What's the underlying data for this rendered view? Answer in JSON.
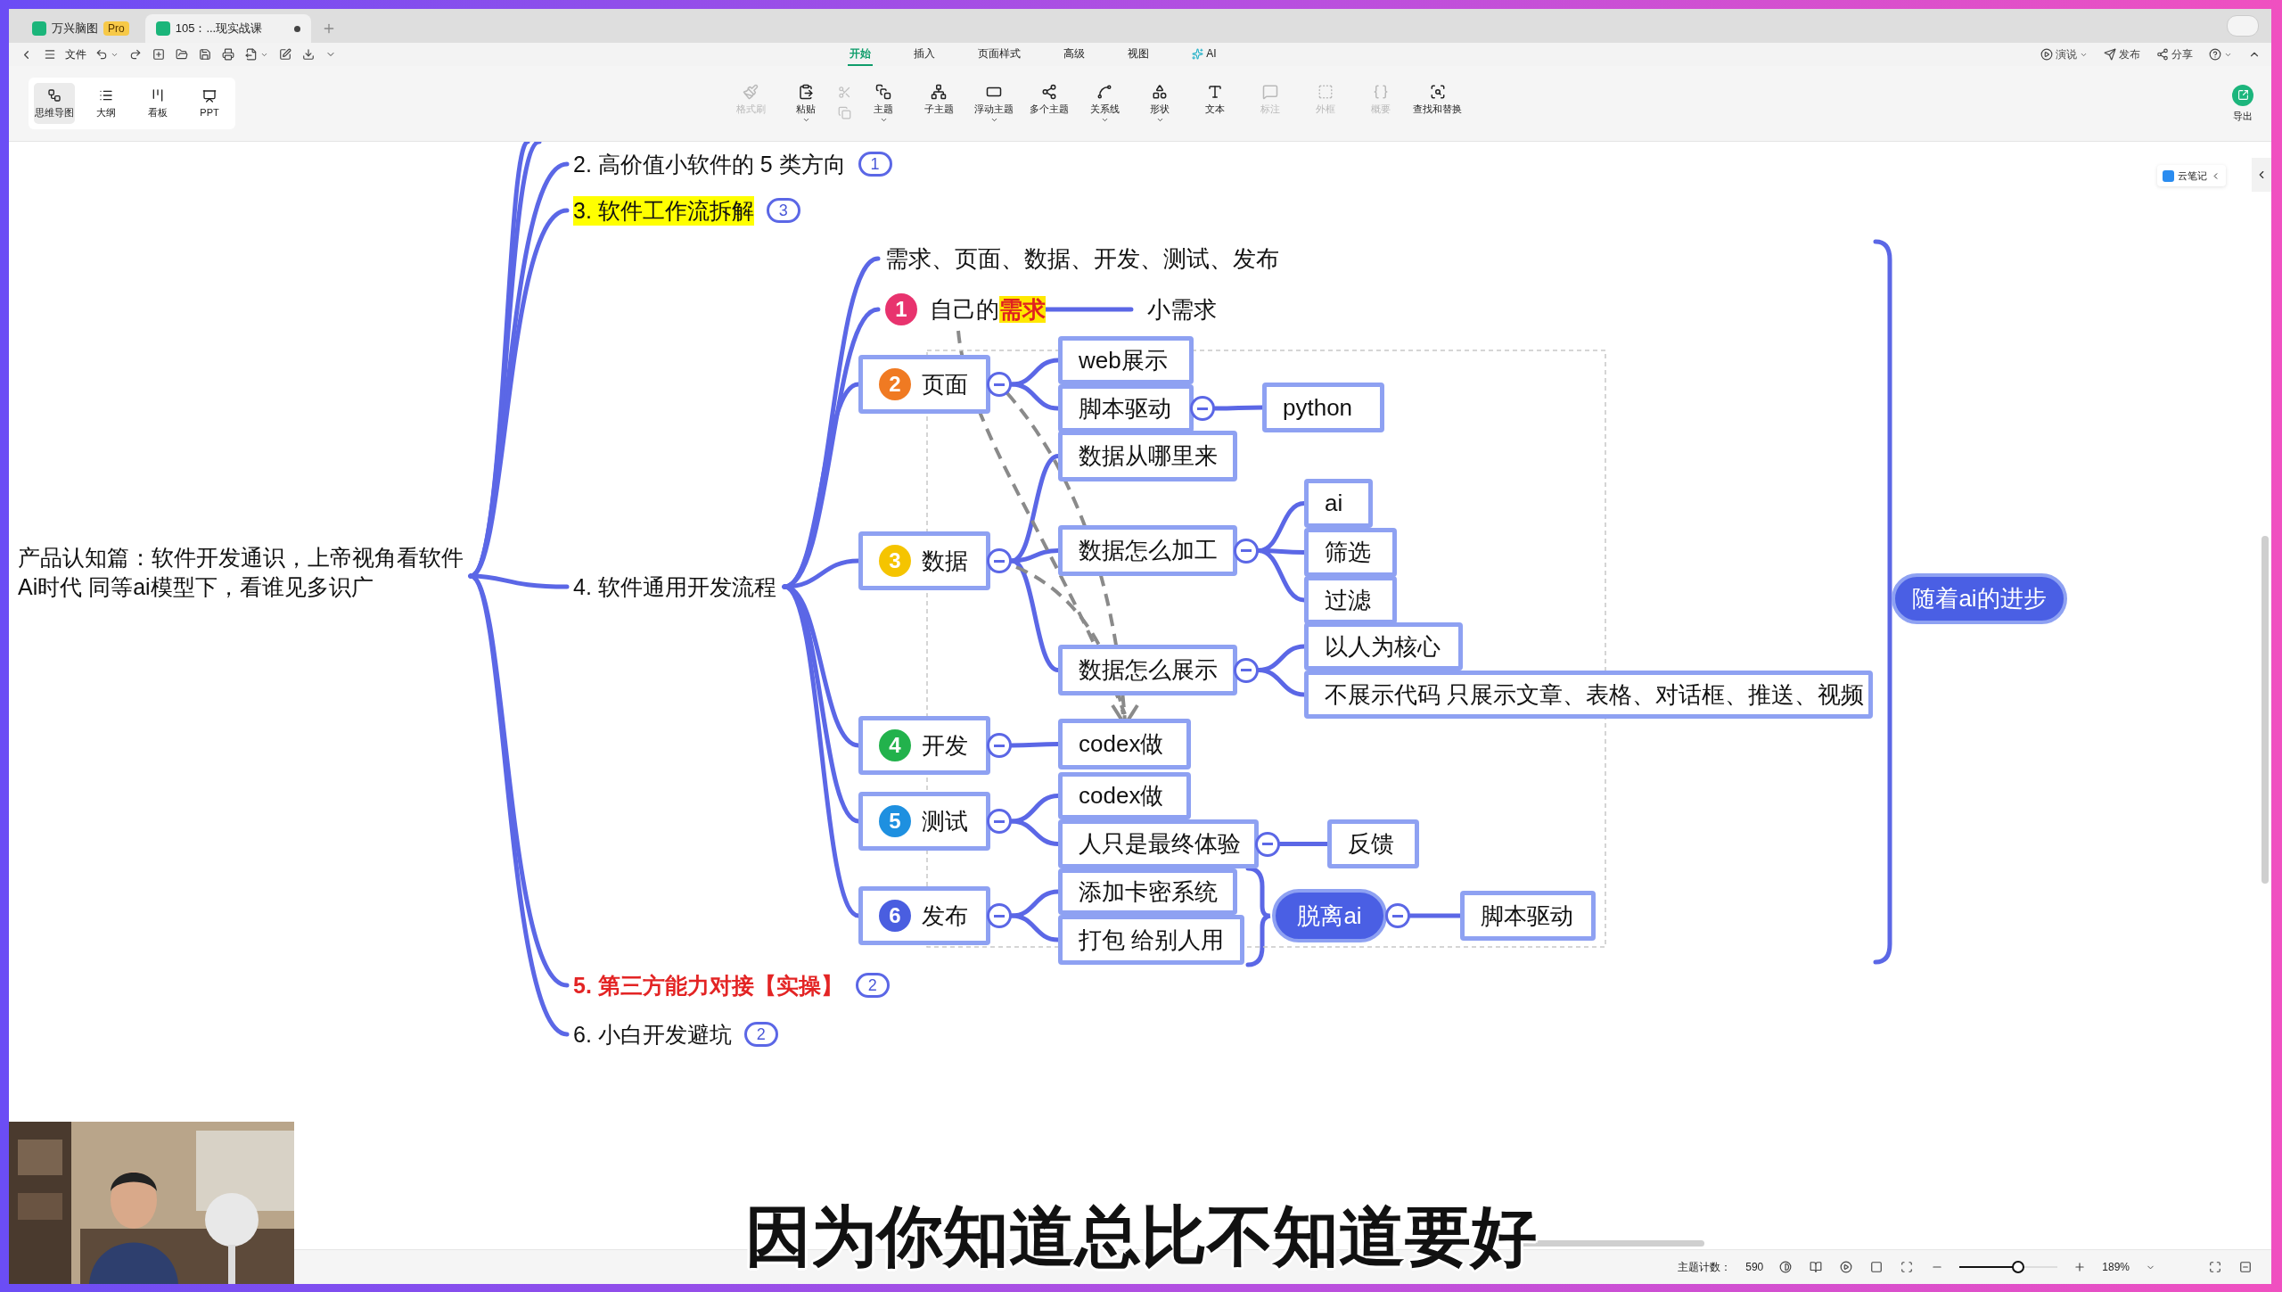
{
  "app_tabs": [
    {
      "label": "万兴脑图",
      "badge": "Pro",
      "selected": false
    },
    {
      "label": "105：...现实战课",
      "selected": true,
      "unsaved": true
    }
  ],
  "menu": {
    "file": "文件",
    "tabs": [
      {
        "label": "开始",
        "selected": true
      },
      {
        "label": "插入",
        "selected": false
      },
      {
        "label": "页面样式",
        "selected": false
      },
      {
        "label": "高级",
        "selected": false
      },
      {
        "label": "视图",
        "selected": false
      },
      {
        "label": "AI",
        "selected": false
      }
    ],
    "actions": [
      "演说",
      "发布",
      "分享"
    ]
  },
  "view_modes": [
    {
      "label": "思维导图",
      "selected": true
    },
    {
      "label": "大纲",
      "selected": false
    },
    {
      "label": "看板",
      "selected": false
    },
    {
      "label": "PPT",
      "selected": false
    }
  ],
  "toolbar": [
    {
      "kind": "tool",
      "label": "格式刷",
      "disabled": true,
      "menu": false
    },
    {
      "kind": "tool",
      "label": "粘贴",
      "disabled": false,
      "menu": true
    },
    {
      "kind": "clip",
      "disabled": true
    },
    {
      "kind": "tool",
      "label": "主题",
      "disabled": false,
      "menu": true
    },
    {
      "kind": "tool",
      "label": "子主题",
      "disabled": false,
      "menu": false
    },
    {
      "kind": "tool",
      "label": "浮动主题",
      "disabled": false,
      "menu": true
    },
    {
      "kind": "tool",
      "label": "多个主题",
      "disabled": false,
      "menu": false
    },
    {
      "kind": "tool",
      "label": "关系线",
      "disabled": false,
      "menu": true
    },
    {
      "kind": "tool",
      "label": "形状",
      "disabled": false,
      "menu": true
    },
    {
      "kind": "tool",
      "label": "文本",
      "disabled": false,
      "menu": false
    },
    {
      "kind": "tool",
      "label": "标注",
      "disabled": true,
      "menu": false
    },
    {
      "kind": "tool",
      "label": "外框",
      "disabled": true,
      "menu": false
    },
    {
      "kind": "tool",
      "label": "概要",
      "disabled": true,
      "menu": false
    },
    {
      "kind": "tool",
      "label": "查找和替换",
      "disabled": false,
      "menu": false
    }
  ],
  "export": "导出",
  "side_panel": {
    "label": "云笔记"
  },
  "mind_map": {
    "root": [
      "产品认知篇：软件开发通识，上帝视角看软件",
      "Ai时代 同等ai模型下，看谁见多识广"
    ],
    "branches": [
      {
        "kind": "plain",
        "label": "2. 高价值小软件的 5 类方向",
        "badge": "1"
      },
      {
        "kind": "highlighted",
        "label": "3. 软件工作流拆解",
        "badge": "3"
      },
      {
        "kind": "plain",
        "label": "4. 软件通用开发流程",
        "summary": {
          "label": "随着ai的进步"
        },
        "children": [
          {
            "kind": "text",
            "label": "需求、页面、数据、开发、测试、发布"
          },
          {
            "kind": "numbered",
            "number": "1",
            "color": "#e8336e",
            "label": "自己的**需求**",
            "children": [
              {
                "label": "小需求"
              }
            ]
          },
          {
            "kind": "boxed",
            "number": "2",
            "color": "#f07a22",
            "label": "页面",
            "expanded": true,
            "children": [
              {
                "label": "web展示"
              },
              {
                "label": "脚本驱动",
                "expanded": true,
                "children": [
                  {
                    "label": "python"
                  }
                ]
              }
            ]
          },
          {
            "kind": "boxed",
            "number": "3",
            "color": "#f5c400",
            "label": "数据",
            "expanded": true,
            "children": [
              {
                "label": "数据从哪里来"
              },
              {
                "label": "数据怎么加工",
                "expanded": true,
                "children": [
                  {
                    "label": "ai"
                  },
                  {
                    "label": "筛选"
                  },
                  {
                    "label": "过滤"
                  }
                ]
              },
              {
                "label": "数据怎么展示",
                "expanded": true,
                "children": [
                  {
                    "label": "以人为核心"
                  },
                  {
                    "label": "不展示代码 只展示文章、表格、对话框、推送、视频"
                  }
                ]
              }
            ]
          },
          {
            "kind": "boxed",
            "number": "4",
            "color": "#22b24c",
            "label": "开发",
            "expanded": true,
            "children": [
              {
                "label": "codex做"
              }
            ]
          },
          {
            "kind": "boxed",
            "number": "5",
            "color": "#1e90e0",
            "label": "测试",
            "expanded": true,
            "children": [
              {
                "label": "codex做"
              },
              {
                "label": "人只是最终体验",
                "expanded": true,
                "children": [
                  {
                    "label": "反馈"
                  }
                ]
              }
            ]
          },
          {
            "kind": "boxed",
            "number": "6",
            "color": "#4a5ee0",
            "label": "发布",
            "expanded": true,
            "children": [
              {
                "label": "添加卡密系统"
              },
              {
                "label": "打包 给别人用"
              }
            ],
            "summary": {
              "label": "脱离ai",
              "expanded": true,
              "children": [
                {
                  "label": "脚本驱动"
                }
              ]
            }
          }
        ]
      },
      {
        "kind": "alert",
        "label": "5. 第三方能力对接【实操】",
        "badge": "2"
      },
      {
        "kind": "plain",
        "label": "6. 小白开发避坑",
        "badge": "2"
      }
    ]
  },
  "status_bar": {
    "topic_count": {
      "label": "主题计数：",
      "value": "590"
    },
    "zoom": {
      "level": 0.6,
      "reading": "189%"
    }
  },
  "subtitle": "因为你知道总比不知道要好"
}
